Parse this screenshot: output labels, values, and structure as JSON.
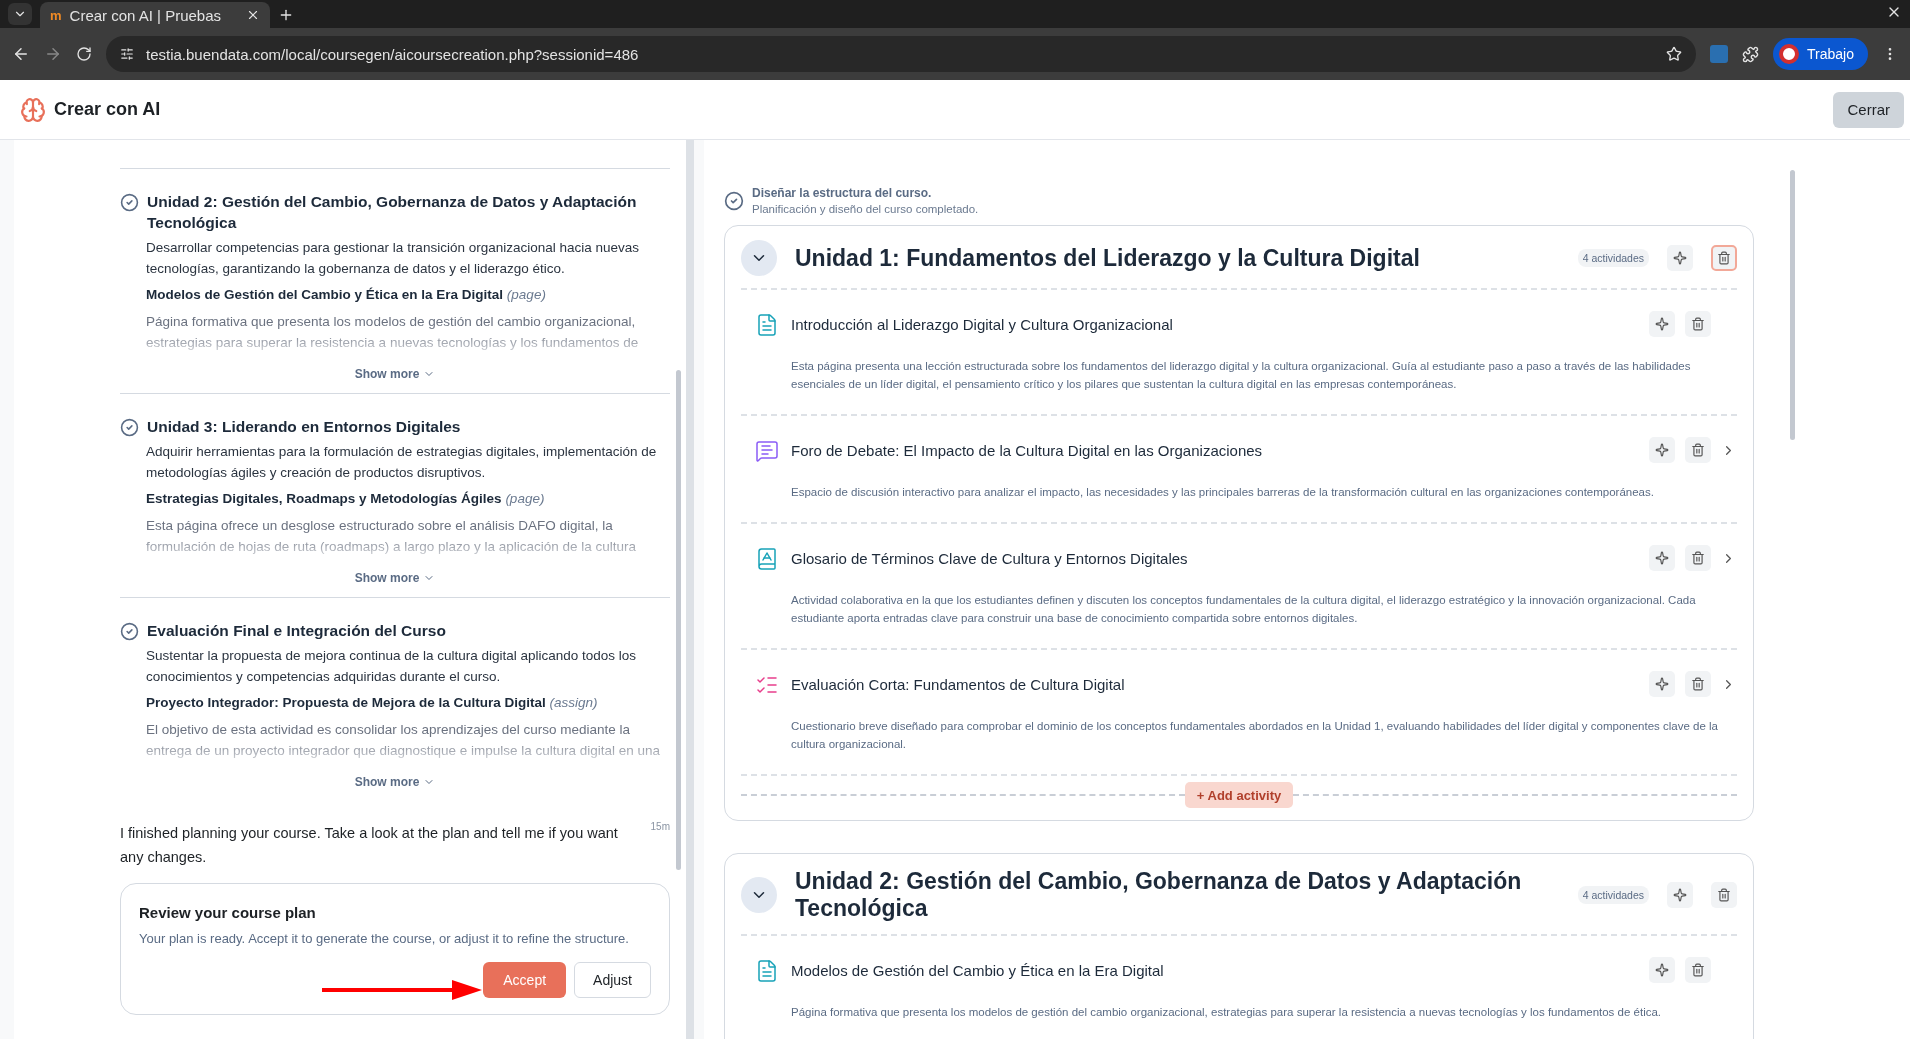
{
  "browser": {
    "favicon": "m",
    "tab_title": "Crear con AI | Pruebas",
    "url": "testia.buendata.com/local/coursegen/aicoursecreation.php?sessionid=486",
    "profile": "Trabajo"
  },
  "header": {
    "title": "Crear con AI",
    "close": "Cerrar"
  },
  "plan": {
    "units": [
      {
        "title": "Unidad 2: Gestión del Cambio, Gobernanza de Datos y Adaptación Tecnológica",
        "description": "Desarrollar competencias para gestionar la transición organizacional hacia nuevas tecnologías, garantizando la gobernanza de datos y el liderazgo ético.",
        "activity": "Modelos de Gestión del Cambio y Ética en la Era Digital",
        "activity_type": "(page)",
        "activity_description": "Página formativa que presenta los modelos de gestión del cambio organizacional, estrategias para superar la resistencia a nuevas tecnologías y los fundamentos de",
        "show_more": "Show more"
      },
      {
        "title": "Unidad 3: Liderando en Entornos Digitales",
        "description": "Adquirir herramientas para la formulación de estrategias digitales, implementación de metodologías ágiles y creación de productos disruptivos.",
        "activity": "Estrategias Digitales, Roadmaps y Metodologías Ágiles",
        "activity_type": "(page)",
        "activity_description": "Esta página ofrece un desglose estructurado sobre el análisis DAFO digital, la formulación de hojas de ruta (roadmaps) a largo plazo y la aplicación de la cultura",
        "show_more": "Show more"
      },
      {
        "title": "Evaluación Final e Integración del Curso",
        "description": "Sustentar la propuesta de mejora continua de la cultura digital aplicando todos los conocimientos y competencias adquiridas durante el curso.",
        "activity": "Proyecto Integrador: Propuesta de Mejora de la Cultura Digital",
        "activity_type": "(assign)",
        "activity_description": "El objetivo de esta actividad es consolidar los aprendizajes del curso mediante la entrega de un proyecto integrador que diagnostique e impulse la cultura digital en una",
        "show_more": "Show more"
      }
    ],
    "message": "I finished planning your course. Take a look at the plan and tell me if you want any changes.",
    "message_time": "15m",
    "review": {
      "title": "Review your course plan",
      "text": "Your plan is ready. Accept it to generate the course, or adjust it to refine the structure.",
      "accept": "Accept",
      "adjust": "Adjust"
    }
  },
  "structure": {
    "status_title": "Diseñar la estructura del curso.",
    "status_text": "Planificación y diseño del curso completado.",
    "units": [
      {
        "title": "Unidad 1: Fundamentos del Liderazgo y la Cultura Digital",
        "count": "4 actividades",
        "delete_highlighted": true,
        "add_activity": "+ Add activity",
        "activities": [
          {
            "kind": "page",
            "title": "Introducción al Liderazgo Digital y Cultura Organizacional",
            "description": "Esta página presenta una lección estructurada sobre los fundamentos del liderazgo digital y la cultura organizacional. Guía al estudiante paso a paso a través de las habilidades esenciales de un líder digital, el pensamiento crítico y los pilares que sustentan la cultura digital en las empresas contemporáneas.",
            "expandable": false
          },
          {
            "kind": "forum",
            "title": "Foro de Debate: El Impacto de la Cultura Digital en las Organizaciones",
            "description": "Espacio de discusión interactivo para analizar el impacto, las necesidades y las principales barreras de la transformación cultural en las organizaciones contemporáneas.",
            "expandable": true
          },
          {
            "kind": "glossary",
            "title": "Glosario de Términos Clave de Cultura y Entornos Digitales",
            "description": "Actividad colaborativa en la que los estudiantes definen y discuten los conceptos fundamentales de la cultura digital, el liderazgo estratégico y la innovación organizacional. Cada estudiante aporta entradas clave para construir una base de conocimiento compartida sobre entornos digitales.",
            "expandable": true
          },
          {
            "kind": "quiz",
            "title": "Evaluación Corta: Fundamentos de Cultura Digital",
            "description": "Cuestionario breve diseñado para comprobar el dominio de los conceptos fundamentales abordados en la Unidad 1, evaluando habilidades del líder digital y componentes clave de la cultura organizacional.",
            "expandable": true
          }
        ]
      },
      {
        "title": "Unidad 2: Gestión del Cambio, Gobernanza de Datos y Adaptación Tecnológica",
        "count": "4 actividades",
        "delete_highlighted": false,
        "activities": [
          {
            "kind": "page",
            "title": "Modelos de Gestión del Cambio y Ética en la Era Digital",
            "description": "Página formativa que presenta los modelos de gestión del cambio organizacional, estrategias para superar la resistencia a nuevas tecnologías y los fundamentos de ética.",
            "expandable": false
          }
        ]
      }
    ]
  }
}
